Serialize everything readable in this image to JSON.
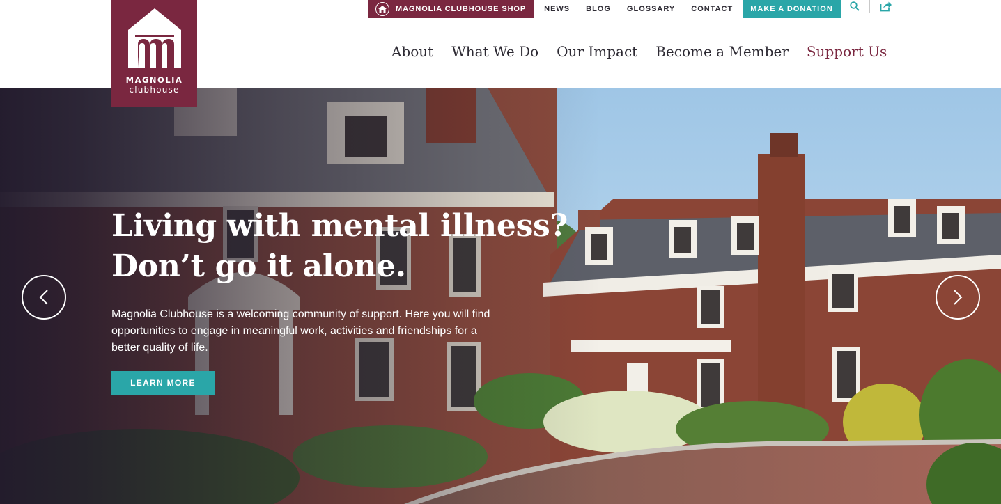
{
  "header": {
    "logo": {
      "name": "MAGNOLIA",
      "sub": "clubhouse",
      "color": "#7a2740"
    },
    "utility": {
      "shop_label": "MAGNOLIA CLUBHOUSE SHOP",
      "links": [
        "NEWS",
        "BLOG",
        "GLOSSARY",
        "CONTACT"
      ],
      "donate_label": "MAKE A DONATION",
      "icons": [
        "search-icon",
        "share-icon"
      ]
    },
    "nav": [
      "About",
      "What We Do",
      "Our Impact",
      "Become a Member",
      "Support Us"
    ]
  },
  "hero": {
    "title_line1": "Living with mental illness?",
    "title_line2": "Don’t go it alone.",
    "body": "Magnolia Clubhouse is a welcoming community of support. Here you will find opportunities to engage in meaningful work, activities and friendships for a better quality of life.",
    "cta_label": "LEARN MORE",
    "prev_icon": "chevron-left-icon",
    "next_icon": "chevron-right-icon"
  },
  "colors": {
    "brand": "#7a2740",
    "accent": "#2aa6a8",
    "text": "#2d2a33"
  }
}
